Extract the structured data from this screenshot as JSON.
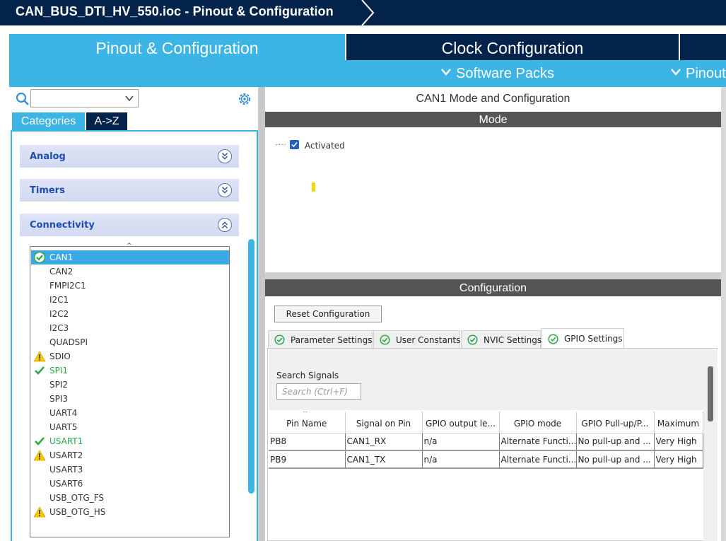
{
  "window": {
    "title": "CAN_BUS_DTI_HV_550.ioc - Pinout & Configuration"
  },
  "top_tabs": {
    "pinout": "Pinout & Configuration",
    "clock": "Clock Configuration"
  },
  "sub_menu": {
    "software_packs": "Software Packs",
    "pinout": "Pinout"
  },
  "left": {
    "search_value": "",
    "tab_categories": "Categories",
    "tab_az": "A->Z",
    "categories": [
      {
        "label": "Analog"
      },
      {
        "label": "Timers"
      },
      {
        "label": "Connectivity"
      }
    ],
    "peripherals": [
      {
        "label": "CAN1",
        "status": "ok",
        "selected": true
      },
      {
        "label": "CAN2",
        "status": "none"
      },
      {
        "label": "FMPI2C1",
        "status": "none"
      },
      {
        "label": "I2C1",
        "status": "none"
      },
      {
        "label": "I2C2",
        "status": "none"
      },
      {
        "label": "I2C3",
        "status": "none"
      },
      {
        "label": "QUADSPI",
        "status": "none"
      },
      {
        "label": "SDIO",
        "status": "warn"
      },
      {
        "label": "SPI1",
        "status": "ok"
      },
      {
        "label": "SPI2",
        "status": "none"
      },
      {
        "label": "SPI3",
        "status": "none"
      },
      {
        "label": "UART4",
        "status": "none"
      },
      {
        "label": "UART5",
        "status": "none"
      },
      {
        "label": "USART1",
        "status": "ok"
      },
      {
        "label": "USART2",
        "status": "warn"
      },
      {
        "label": "USART3",
        "status": "none"
      },
      {
        "label": "USART6",
        "status": "none"
      },
      {
        "label": "USB_OTG_FS",
        "status": "none"
      },
      {
        "label": "USB_OTG_HS",
        "status": "warn"
      }
    ]
  },
  "right": {
    "panel_title": "CAN1 Mode and Configuration",
    "mode_header": "Mode",
    "activated_label": "Activated",
    "activated_checked": true,
    "config_header": "Configuration",
    "reset_button": "Reset Configuration",
    "config_tabs": [
      {
        "label": "Parameter Settings"
      },
      {
        "label": "User Constants"
      },
      {
        "label": "NVIC Settings"
      },
      {
        "label": "GPIO Settings",
        "active": true
      }
    ],
    "search_signals_label": "Search Signals",
    "search_signals_placeholder": "Search (Ctrl+F)",
    "table": {
      "columns": [
        "Pin Name",
        "Signal on Pin",
        "GPIO output le...",
        "GPIO mode",
        "GPIO Pull-up/P...",
        "Maximum"
      ],
      "rows": [
        [
          "PB8",
          "CAN1_RX",
          "n/a",
          "Alternate Functi...",
          "No pull-up and ...",
          "Very High"
        ],
        [
          "PB9",
          "CAN1_TX",
          "n/a",
          "Alternate Functi...",
          "No pull-up and ...",
          "Very High"
        ]
      ]
    }
  },
  "colors": {
    "accent": "#3cb4e6",
    "dark_navy": "#03234b",
    "ok_green": "#2ea64a",
    "warn_yellow": "#f5c800",
    "header_gray": "#555555"
  }
}
